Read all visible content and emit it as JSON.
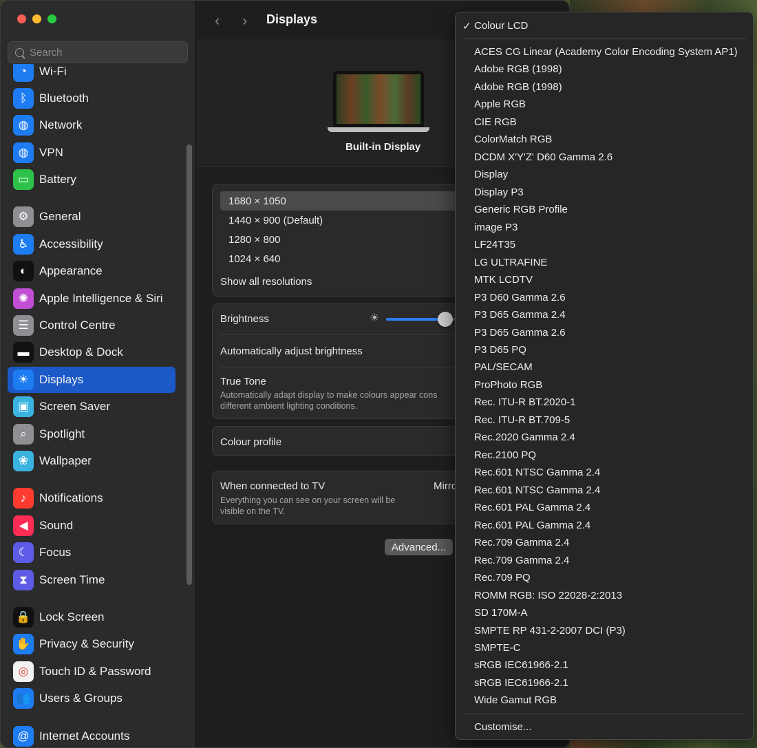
{
  "window": {
    "title": "Displays",
    "search_placeholder": "Search"
  },
  "sidebar": {
    "items": [
      {
        "label": "Wi-Fi",
        "icon": "wifi-icon",
        "color": "#1e7cf2",
        "glyph": "◔"
      },
      {
        "label": "Bluetooth",
        "icon": "bluetooth-icon",
        "color": "#1e7cf2",
        "glyph": "ᛒ"
      },
      {
        "label": "Network",
        "icon": "globe-icon",
        "color": "#1e7cf2",
        "glyph": "◍"
      },
      {
        "label": "VPN",
        "icon": "vpn-globe-icon",
        "color": "#1e7cf2",
        "glyph": "◍"
      },
      {
        "label": "Battery",
        "icon": "battery-icon",
        "color": "#2fc24a",
        "glyph": "▭"
      },
      {
        "label": "General",
        "icon": "gear-icon",
        "color": "#8e8e93",
        "glyph": "⚙"
      },
      {
        "label": "Accessibility",
        "icon": "accessibility-icon",
        "color": "#1e7cf2",
        "glyph": "♿"
      },
      {
        "label": "Appearance",
        "icon": "appearance-icon",
        "color": "#111111",
        "glyph": "◐"
      },
      {
        "label": "Apple Intelligence & Siri",
        "icon": "siri-icon",
        "color": "#c04fd4",
        "glyph": "✺"
      },
      {
        "label": "Control Centre",
        "icon": "toggles-icon",
        "color": "#8e8e93",
        "glyph": "☰"
      },
      {
        "label": "Desktop & Dock",
        "icon": "dock-icon",
        "color": "#111111",
        "glyph": "▬"
      },
      {
        "label": "Displays",
        "icon": "sun-icon",
        "color": "#1e7cf2",
        "glyph": "☀"
      },
      {
        "label": "Screen Saver",
        "icon": "screen-saver-icon",
        "color": "#3bb3e0",
        "glyph": "▣"
      },
      {
        "label": "Spotlight",
        "icon": "magnifier-icon",
        "color": "#8e8e93",
        "glyph": "⌕"
      },
      {
        "label": "Wallpaper",
        "icon": "flower-icon",
        "color": "#3bb3e0",
        "glyph": "❀"
      },
      {
        "label": "Notifications",
        "icon": "bell-icon",
        "color": "#ff3b30",
        "glyph": "♪"
      },
      {
        "label": "Sound",
        "icon": "speaker-icon",
        "color": "#ff2d55",
        "glyph": "◀"
      },
      {
        "label": "Focus",
        "icon": "moon-icon",
        "color": "#5e5ce6",
        "glyph": "☾"
      },
      {
        "label": "Screen Time",
        "icon": "hourglass-icon",
        "color": "#5e5ce6",
        "glyph": "⧗"
      },
      {
        "label": "Lock Screen",
        "icon": "lock-icon",
        "color": "#111111",
        "glyph": "🔒"
      },
      {
        "label": "Privacy & Security",
        "icon": "hand-icon",
        "color": "#1e7cf2",
        "glyph": "✋"
      },
      {
        "label": "Touch ID & Password",
        "icon": "fingerprint-icon",
        "color": "#f2f2f2",
        "glyph": "◎"
      },
      {
        "label": "Users & Groups",
        "icon": "users-icon",
        "color": "#1e7cf2",
        "glyph": "👥"
      },
      {
        "label": "Internet Accounts",
        "icon": "at-icon",
        "color": "#1e7cf2",
        "glyph": "@"
      }
    ]
  },
  "main": {
    "display_name": "Built-in Display",
    "resolutions": [
      "1680 × 1050",
      "1440 × 900 (Default)",
      "1280 × 800",
      "1024 × 640"
    ],
    "show_all_resolutions": "Show all resolutions",
    "brightness_label": "Brightness",
    "brightness_level": 0.72,
    "auto_brightness_label": "Automatically adjust brightness",
    "true_tone_label": "True Tone",
    "true_tone_desc_1": "Automatically adapt display to make colours appear cons",
    "true_tone_desc_2": "different ambient lighting conditions.",
    "colour_profile_label": "Colour profile",
    "tv_label": "When connected to TV",
    "tv_value": "Mirro",
    "tv_desc_1": "Everything you can see on your screen will be",
    "tv_desc_2": "visible on the TV.",
    "advanced_button": "Advanced..."
  },
  "menu": {
    "checkmark": "✓",
    "selected": "Colour LCD",
    "items": [
      "ACES CG Linear (Academy Color Encoding System AP1)",
      "Adobe RGB (1998)",
      "Adobe RGB (1998)",
      "Apple RGB",
      "CIE RGB",
      "ColorMatch RGB",
      "DCDM X'Y'Z' D60 Gamma 2.6",
      "Display",
      "Display P3",
      "Generic RGB Profile",
      "image P3",
      "LF24T35",
      "LG ULTRAFINE",
      "MTK LCDTV",
      "P3 D60 Gamma 2.6",
      "P3 D65 Gamma 2.4",
      "P3 D65 Gamma 2.6",
      "P3 D65 PQ",
      "PAL/SECAM",
      "ProPhoto RGB",
      "Rec. ITU-R BT.2020-1",
      "Rec. ITU-R BT.709-5",
      "Rec.2020 Gamma 2.4",
      "Rec.2100 PQ",
      "Rec.601 NTSC Gamma 2.4",
      "Rec.601 NTSC Gamma 2.4",
      "Rec.601 PAL Gamma 2.4",
      "Rec.601 PAL Gamma 2.4",
      "Rec.709 Gamma 2.4",
      "Rec.709 Gamma 2.4",
      "Rec.709 PQ",
      "ROMM RGB: ISO 22028-2:2013",
      "SD 170M-A",
      "SMPTE RP 431-2-2007 DCI (P3)",
      "SMPTE-C",
      "sRGB IEC61966-2.1",
      "sRGB IEC61966-2.1",
      "Wide Gamut RGB"
    ],
    "customise": "Customise..."
  }
}
